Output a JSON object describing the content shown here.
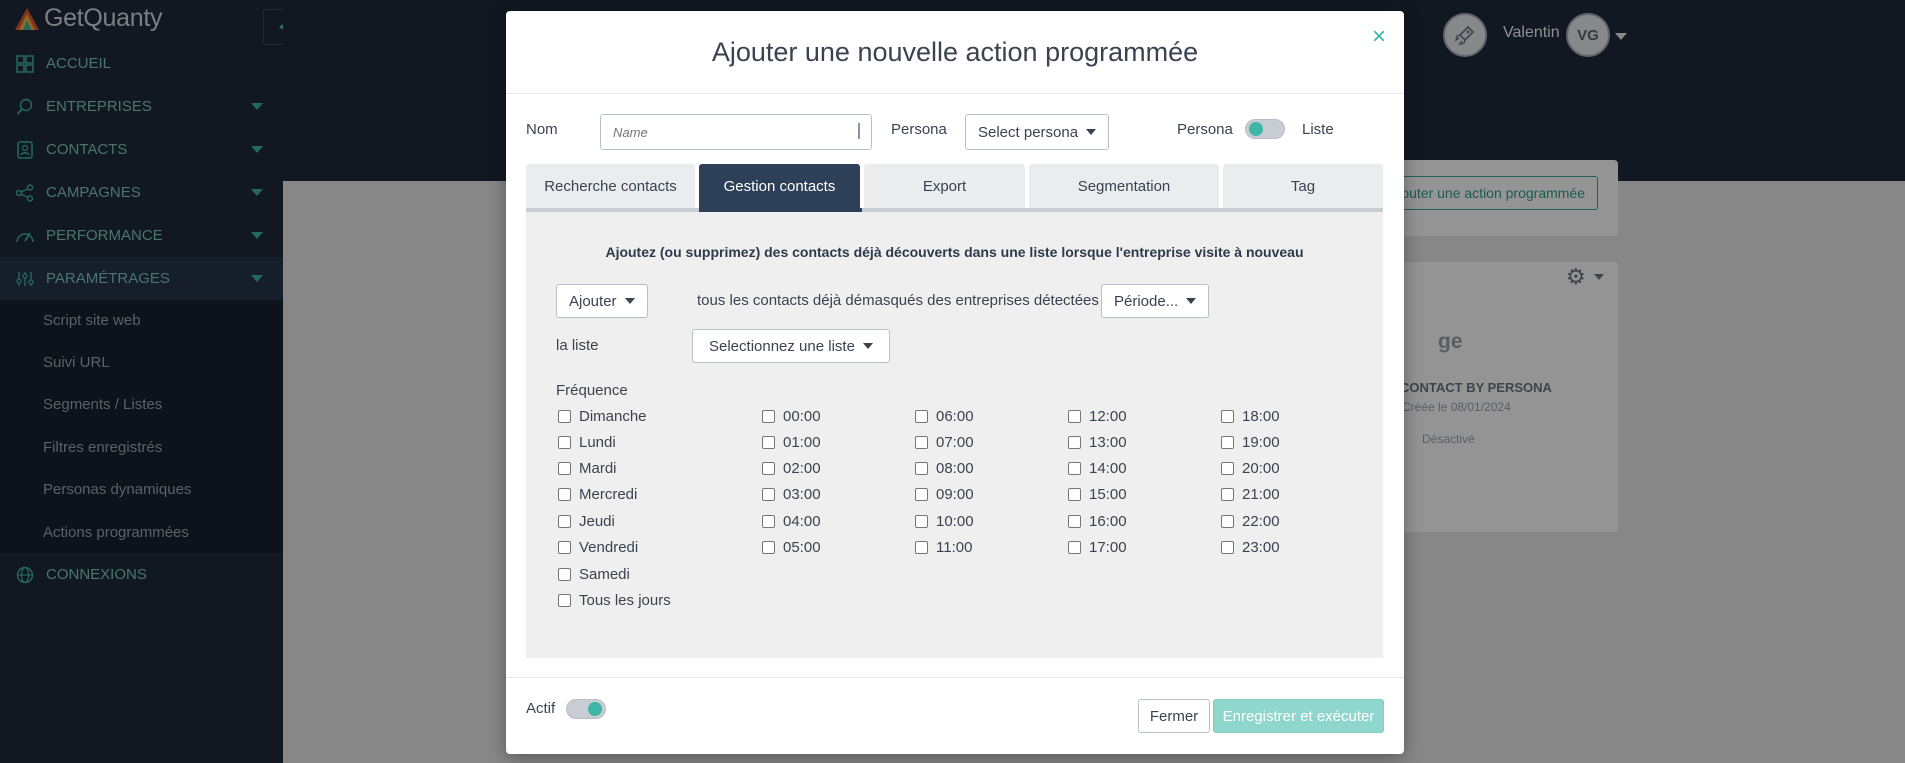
{
  "app": {
    "logo_text": "GetQuanty"
  },
  "sidebar": {
    "items": [
      {
        "label": "ACCUEIL",
        "icon": "grid-icon"
      },
      {
        "label": "ENTREPRISES",
        "icon": "search-icon"
      },
      {
        "label": "CONTACTS",
        "icon": "contact-card-icon"
      },
      {
        "label": "CAMPAGNES",
        "icon": "share-nodes-icon"
      },
      {
        "label": "PERFORMANCE",
        "icon": "speedometer-icon"
      },
      {
        "label": "PARAMÉTRAGES",
        "icon": "sliders-icon"
      },
      {
        "label": "CONNEXIONS",
        "icon": "globe-icon"
      }
    ],
    "sub_items": [
      "Script site web",
      "Suivi URL",
      "Segments / Listes",
      "Filtres enregistrés",
      "Personas dynamiques",
      "Actions programmées"
    ]
  },
  "topbar": {
    "user_name": "Valentin",
    "avatar_initials": "VG"
  },
  "background": {
    "add_action_button": "Ajouter une action programmée",
    "card_title_fragment": "ge",
    "card_contact_label": "CONTACT BY PERSONA",
    "card_date": "Créée le 08/01/2024",
    "card_status": "Désactivé"
  },
  "modal": {
    "title": "Ajouter une nouvelle action programmée",
    "close_symbol": "×",
    "name_label": "Nom",
    "name_placeholder": "Name",
    "persona_label": "Persona",
    "persona_select": "Select persona",
    "toggle_left_label": "Persona",
    "toggle_right_label": "Liste",
    "tabs": [
      "Recherche contacts",
      "Gestion contacts",
      "Export",
      "Segmentation",
      "Tag"
    ],
    "active_tab": "Gestion contacts",
    "panel": {
      "intro": "Ajoutez (ou supprimez) des contacts déjà découverts dans une liste lorsque l'entreprise visite à nouveau",
      "action_select": "Ajouter",
      "contacts_text": "tous les contacts déjà démasqués des entreprises détectées",
      "period_select": "Période...",
      "list_label": "la liste",
      "list_select": "Selectionnez une liste",
      "frequency_label": "Fréquence",
      "days": [
        "Dimanche",
        "Lundi",
        "Mardi",
        "Mercredi",
        "Jeudi",
        "Vendredi",
        "Samedi",
        "Tous les jours"
      ],
      "hours": [
        [
          "00:00",
          "01:00",
          "02:00",
          "03:00",
          "04:00",
          "05:00"
        ],
        [
          "06:00",
          "07:00",
          "08:00",
          "09:00",
          "10:00",
          "11:00"
        ],
        [
          "12:00",
          "13:00",
          "14:00",
          "15:00",
          "16:00",
          "17:00"
        ],
        [
          "18:00",
          "19:00",
          "20:00",
          "21:00",
          "22:00",
          "23:00"
        ]
      ]
    },
    "footer": {
      "active_label": "Actif",
      "close_button": "Fermer",
      "save_button": "Enregistrer et exécuter"
    }
  },
  "colors": {
    "accent": "#3fb5a5",
    "sidebar": "#1e2a3a",
    "active_tab": "#2d4058"
  }
}
